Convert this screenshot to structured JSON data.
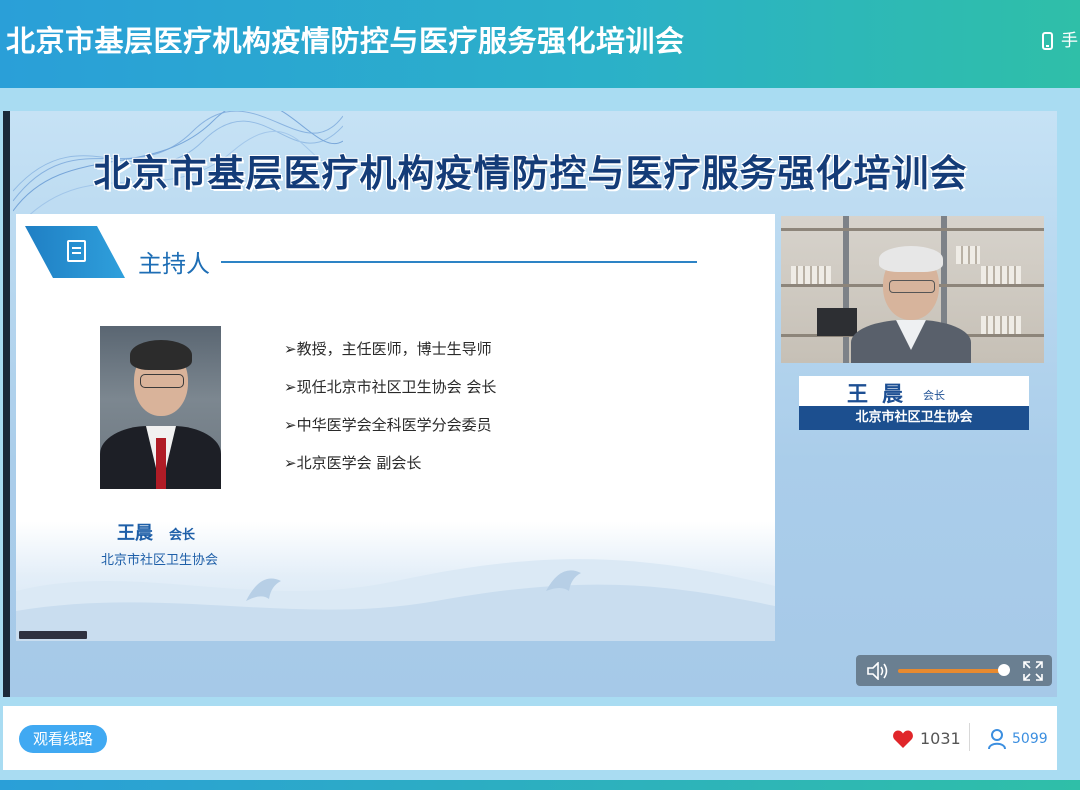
{
  "header": {
    "title": "北京市基层医疗机构疫情防控与医疗服务强化培训会",
    "mobile_label": "手"
  },
  "slide": {
    "title": "北京市基层医疗机构疫情防控与医疗服务强化培训会",
    "section_label": "主持人",
    "bullets": [
      "➢教授，主任医师，博士生导师",
      "➢现任北京市社区卫生协会 会长",
      "➢中华医学会全科医学分会委员",
      "➢北京医学会 副会长"
    ],
    "presenter_name": "王晨",
    "presenter_role": "会长",
    "presenter_org": "北京市社区卫生协会"
  },
  "camera": {
    "name": "王晨",
    "role": "会长",
    "org": "北京市社区卫生协会"
  },
  "player": {
    "volume_level": 0.95
  },
  "footer": {
    "route_button": "观看线路",
    "likes": "1031",
    "viewers": "5099"
  },
  "colors": {
    "accent": "#2a9fd8",
    "brand_dark": "#1c4f8f",
    "like_red": "#e0262a",
    "volume_orange": "#e88a2f"
  }
}
